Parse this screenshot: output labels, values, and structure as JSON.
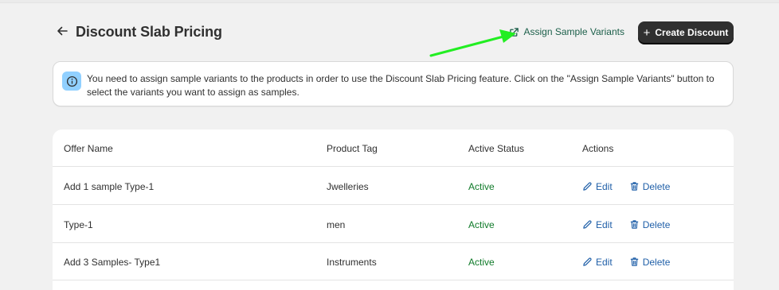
{
  "header": {
    "title": "Discount Slab Pricing",
    "assign_link": "Assign Sample Variants",
    "create_button": "Create Discount"
  },
  "banner": {
    "text": "You need to assign sample variants to the products in order to use the Discount Slab Pricing feature. Click on the \"Assign Sample Variants\" button to select the variants you want to assign as samples."
  },
  "table": {
    "columns": [
      "Offer Name",
      "Product Tag",
      "Active Status",
      "Actions"
    ],
    "rows": [
      {
        "offer": "Add 1 sample Type-1",
        "tag": "Jwelleries",
        "status": "Active"
      },
      {
        "offer": "Type-1",
        "tag": "men",
        "status": "Active"
      },
      {
        "offer": "Add 3 Samples- Type1",
        "tag": "Instruments",
        "status": "Active"
      }
    ],
    "edit_label": "Edit",
    "delete_label": "Delete"
  },
  "colors": {
    "accent_green_arrow": "#22ee22",
    "active_status": "#0f7a29",
    "action_link": "#1f5fa8",
    "primary_button": "#303030",
    "info_icon_bg": "#91d0ff"
  }
}
